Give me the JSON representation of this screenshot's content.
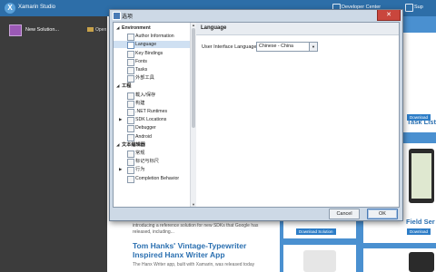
{
  "app": {
    "title": "Xamarin Studio",
    "logo_letter": "X"
  },
  "topbar": {
    "dev_center": "Developer Center",
    "support": "Sup"
  },
  "sidebar": {
    "new_solution": "New Solution...",
    "open": "Open"
  },
  "center": {
    "news_intro": "introducing a reference solution for new SDKs that Google has released, including...",
    "news_title": "Tom Hanks' Vintage-Typewriter Inspired Hanx Writer App",
    "news_body": "The Hanx Writer app, built with Xamarin, was released today"
  },
  "store": {
    "card1_title": "Task List",
    "card2_title": "Field Ser",
    "download": "Download",
    "download_solution": "Download Solution"
  },
  "dialog": {
    "title": "选项",
    "close": "✕",
    "tree": [
      {
        "type": "group",
        "label": "Environment",
        "expanded": true
      },
      {
        "type": "item",
        "label": "Author Information"
      },
      {
        "type": "item",
        "label": "Language",
        "selected": true
      },
      {
        "type": "item",
        "label": "Key Bindings"
      },
      {
        "type": "item",
        "label": "Fonts"
      },
      {
        "type": "item",
        "label": "Tasks"
      },
      {
        "type": "item",
        "label": "外部工具"
      },
      {
        "type": "group",
        "label": "工程",
        "expanded": true
      },
      {
        "type": "item",
        "label": "载入/保存"
      },
      {
        "type": "item",
        "label": "构建"
      },
      {
        "type": "item",
        "label": ".NET Runtimes"
      },
      {
        "type": "subgroup",
        "label": "SDK Locations"
      },
      {
        "type": "item",
        "label": "Debugger"
      },
      {
        "type": "item",
        "label": "Android"
      },
      {
        "type": "group",
        "label": "文本编辑器",
        "expanded": true
      },
      {
        "type": "item",
        "label": "常规"
      },
      {
        "type": "item",
        "label": "标记与标尺"
      },
      {
        "type": "subgroup",
        "label": "行为"
      },
      {
        "type": "item",
        "label": "Completion Behavior"
      }
    ],
    "panel_title": "Language",
    "ui_language_label": "User Interface Language:",
    "ui_language_value": "Chinese - China",
    "cancel": "Cancel",
    "ok": "OK"
  },
  "colors": {
    "accent": "#2d6ea8",
    "selection": "#cfe0f2",
    "close": "#c9463d"
  }
}
